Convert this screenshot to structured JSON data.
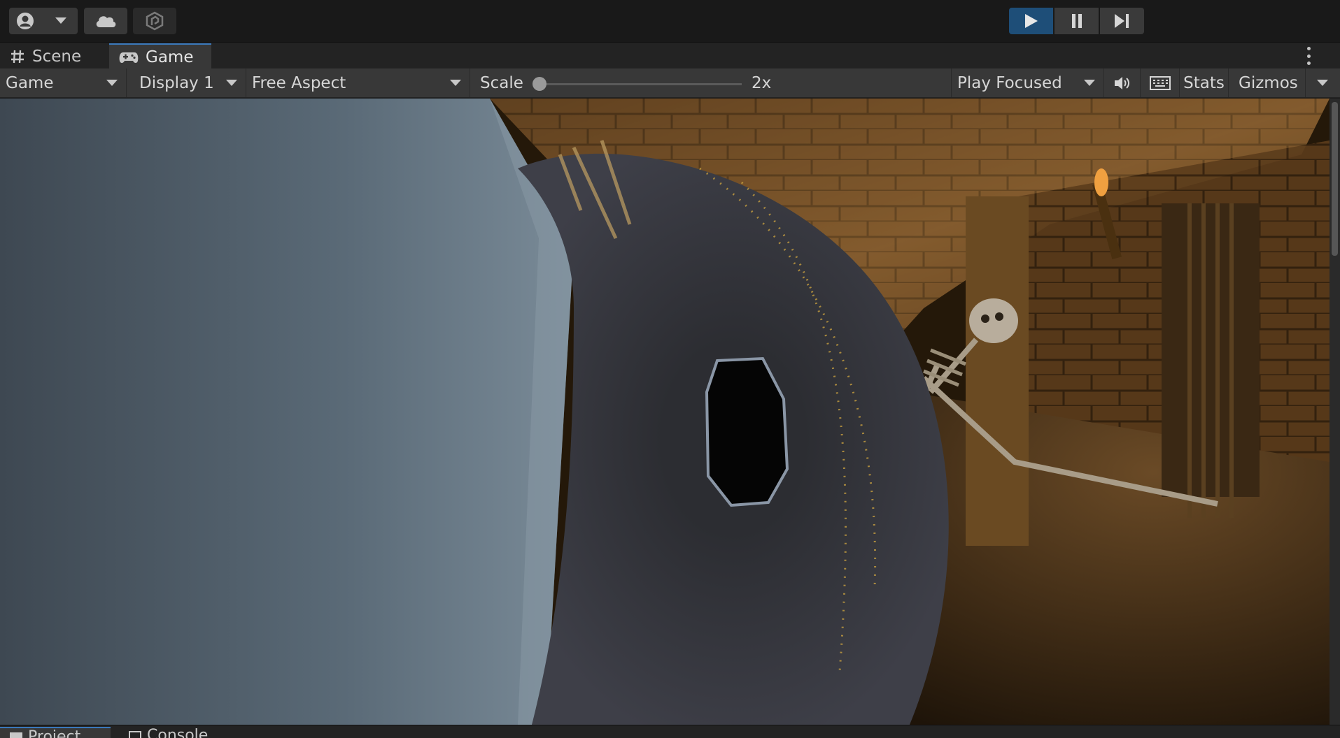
{
  "toolbar": {
    "account_icon": "account-icon",
    "cloud_icon": "cloud-icon",
    "collab_icon": "collab-icon",
    "play_icon": "play-icon",
    "pause_icon": "pause-icon",
    "step_icon": "step-icon",
    "play_active": true
  },
  "tabs": [
    {
      "label": "Scene",
      "icon": "grid-icon"
    },
    {
      "label": "Game",
      "icon": "gamepad-icon",
      "active": true
    }
  ],
  "game_toolbar": {
    "mode_dropdown": "Game",
    "display_dropdown": "Display 1",
    "aspect_dropdown": "Free Aspect",
    "scale_label": "Scale",
    "scale_value": "2x",
    "scale_slider_fraction": 0.0,
    "play_mode_dropdown": "Play Focused",
    "audio_icon": "speaker-icon",
    "keyboard_icon": "keyboard-icon",
    "stats_label": "Stats",
    "gizmos_label": "Gizmos"
  },
  "bottom_tabs": [
    {
      "label": "Project",
      "icon": "folder-icon",
      "active": true
    },
    {
      "label": "Console",
      "icon": "console-icon"
    }
  ],
  "colors": {
    "accent": "#3a79bb",
    "play_active": "#1e4e78",
    "panel": "#383838",
    "background": "#191919"
  }
}
